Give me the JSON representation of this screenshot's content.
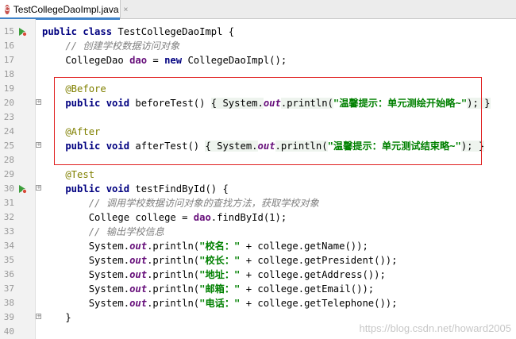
{
  "tab": {
    "icon_letter": "C",
    "label": "TestCollegeDaoImpl.java",
    "close": "×"
  },
  "lines": [
    {
      "n": "15",
      "parts": [
        [
          "kw",
          "public class "
        ],
        [
          "",
          "TestCollegeDaoImpl {"
        ]
      ]
    },
    {
      "n": "16",
      "parts": [
        [
          "cm",
          "    // 创建学校数据访问对象"
        ]
      ]
    },
    {
      "n": "17",
      "parts": [
        [
          "",
          "    CollegeDao "
        ],
        [
          "fd",
          "dao"
        ],
        [
          "",
          " = "
        ],
        [
          "kw",
          "new "
        ],
        [
          "",
          "CollegeDaoImpl();"
        ]
      ]
    },
    {
      "n": "18",
      "parts": []
    },
    {
      "n": "19",
      "parts": [
        [
          "an",
          "    @Before"
        ]
      ]
    },
    {
      "n": "20",
      "parts": [
        [
          "kw",
          "    public void "
        ],
        [
          "",
          "beforeTest() "
        ],
        [
          "fb",
          "{ System."
        ],
        [
          "sf",
          "out"
        ],
        [
          "fb",
          ".println("
        ],
        [
          "st",
          "\"温馨提示：单元测绘开始略~\""
        ],
        [
          "fb",
          "); }"
        ]
      ]
    },
    {
      "n": "23",
      "parts": []
    },
    {
      "n": "24",
      "parts": [
        [
          "an",
          "    @After"
        ]
      ]
    },
    {
      "n": "25",
      "parts": [
        [
          "kw",
          "    public void "
        ],
        [
          "",
          "afterTest() "
        ],
        [
          "fb",
          "{ System."
        ],
        [
          "sf",
          "out"
        ],
        [
          "fb",
          ".println("
        ],
        [
          "st",
          "\"温馨提示：单元测试结束略~\""
        ],
        [
          "fb",
          "); }"
        ]
      ]
    },
    {
      "n": "28",
      "parts": []
    },
    {
      "n": "29",
      "parts": [
        [
          "an",
          "    @Test"
        ]
      ]
    },
    {
      "n": "30",
      "parts": [
        [
          "kw",
          "    public void "
        ],
        [
          "",
          "testFindById() {"
        ]
      ]
    },
    {
      "n": "31",
      "parts": [
        [
          "cm",
          "        // 调用学校数据访问对象的查找方法，获取学校对象"
        ]
      ]
    },
    {
      "n": "32",
      "parts": [
        [
          "",
          "        College college = "
        ],
        [
          "fd",
          "dao"
        ],
        [
          "",
          ".findById(1);"
        ]
      ]
    },
    {
      "n": "33",
      "parts": [
        [
          "cm",
          "        // 输出学校信息"
        ]
      ]
    },
    {
      "n": "34",
      "parts": [
        [
          "",
          "        System."
        ],
        [
          "sf",
          "out"
        ],
        [
          "",
          ".println("
        ],
        [
          "st",
          "\"校名：\""
        ],
        [
          "",
          " + college.getName());"
        ]
      ]
    },
    {
      "n": "35",
      "parts": [
        [
          "",
          "        System."
        ],
        [
          "sf",
          "out"
        ],
        [
          "",
          ".println("
        ],
        [
          "st",
          "\"校长：\""
        ],
        [
          "",
          " + college.getPresident());"
        ]
      ]
    },
    {
      "n": "36",
      "parts": [
        [
          "",
          "        System."
        ],
        [
          "sf",
          "out"
        ],
        [
          "",
          ".println("
        ],
        [
          "st",
          "\"地址：\""
        ],
        [
          "",
          " + college.getAddress());"
        ]
      ]
    },
    {
      "n": "37",
      "parts": [
        [
          "",
          "        System."
        ],
        [
          "sf",
          "out"
        ],
        [
          "",
          ".println("
        ],
        [
          "st",
          "\"邮箱：\""
        ],
        [
          "",
          " + college.getEmail());"
        ]
      ]
    },
    {
      "n": "38",
      "parts": [
        [
          "",
          "        System."
        ],
        [
          "sf",
          "out"
        ],
        [
          "",
          ".println("
        ],
        [
          "st",
          "\"电话：\""
        ],
        [
          "",
          " + college.getTelephone());"
        ]
      ]
    },
    {
      "n": "39",
      "parts": [
        [
          "",
          "    }"
        ]
      ]
    },
    {
      "n": "40",
      "parts": []
    }
  ],
  "gutter_icons": {
    "15": "run-icon",
    "30": "run-icon"
  },
  "fold_lines": [
    "20",
    "25",
    "30",
    "39"
  ],
  "watermark": "https://blog.csdn.net/howard2005",
  "colors": {
    "keyword": "#000080",
    "comment": "#808080",
    "annotation": "#808000",
    "string": "#008000",
    "field": "#660e7a",
    "highlight_box": "#e02020"
  }
}
